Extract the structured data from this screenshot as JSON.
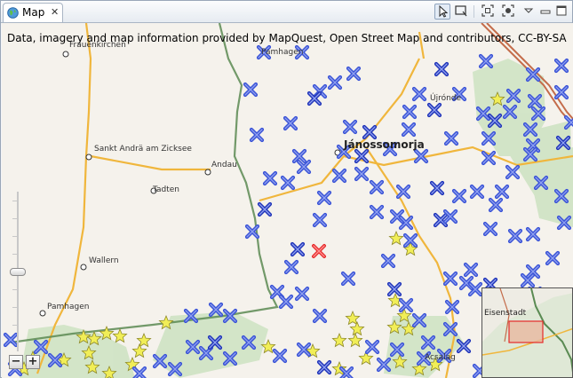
{
  "tab": {
    "title": "Map",
    "icon": "globe-icon",
    "close_glyph": "✕"
  },
  "toolbar": {
    "icons": [
      "pointer-tool-icon",
      "zoom-box-tool-icon",
      "fit-all-icon",
      "center-icon",
      "view-menu-icon",
      "minimize-icon",
      "maximize-icon"
    ]
  },
  "map": {
    "attribution": "Data, imagery and map information provided by MapQuest, Open Street Map and contributors, CC-BY-SA",
    "places": {
      "frauenkirchen": "Frauenkirchen",
      "pamhagen_top": "Pamhagen",
      "ujronde": "Újrónde",
      "sankt_andra": "Sankt Andrä am Zicksee",
      "andau": "Andau",
      "tadten": "Tadten",
      "wallern": "Wallern",
      "pamhagen": "Pamhagen",
      "jánossomorja": "Jánossomorja",
      "acsalag": "Acsalag"
    },
    "zoom": {
      "in_label": "+",
      "out_label": "−",
      "level": 0.5
    },
    "minimap": {
      "place": "Eisenstadt"
    },
    "colors": {
      "marker_blue": "#3a53d6",
      "marker_selected": "#e52a2a",
      "star_yellow": "#f1ee57",
      "road": "#f0b63c",
      "border": "#5a8a52"
    }
  }
}
